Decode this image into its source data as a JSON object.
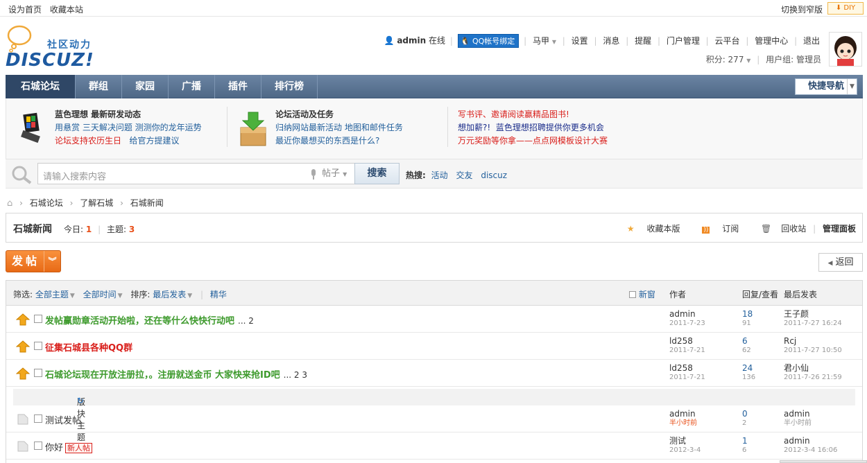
{
  "topbar": {
    "left_links": [
      "设为首页",
      "收藏本站"
    ],
    "right_link": "切换到窄版",
    "diy": "DIY"
  },
  "logo": {
    "brand": "DISCUZ!",
    "slogan": "社区动力"
  },
  "user": {
    "name": "admin",
    "status": "在线",
    "qq_bind": "QQ帐号绑定",
    "menu": [
      "马甲",
      "设置",
      "消息",
      "提醒",
      "门户管理",
      "云平台",
      "管理中心",
      "退出"
    ],
    "score_label": "积分: 277",
    "group_label": "用户组: 管理员"
  },
  "nav": {
    "items": [
      "石城论坛",
      "群组",
      "家园",
      "广播",
      "插件",
      "排行榜"
    ],
    "quick": "快捷导航"
  },
  "feature": {
    "col1": {
      "title": "蓝色理想 最新研发动态",
      "line1": "用悬赏 三天解决问题 测测你的龙年运势",
      "line2a": "论坛支持农历生日",
      "line2b": "给官方提建议"
    },
    "col2": {
      "title": "论坛活动及任务",
      "line1": "归纳网站最新活动 地图和邮件任务",
      "line2": "最近你最想买的东西是什么?"
    },
    "col3": {
      "line1": "写书评、邀请阅读赢精品图书!",
      "line2a": "想加薪?!",
      "line2b": "蓝色理想招聘提供你更多机会",
      "line3": "万元奖励等你拿——点点网模板设计大赛"
    }
  },
  "search": {
    "placeholder": "请输入搜索内容",
    "type": "帖子",
    "button": "搜索",
    "hot_label": "热搜:",
    "hot": [
      "活动",
      "交友",
      "discuz"
    ]
  },
  "breadcrumb": [
    "石城论坛",
    "了解石城",
    "石城新闻"
  ],
  "forum": {
    "title": "石城新闻",
    "today_label": "今日:",
    "today": "1",
    "topics_label": "主题:",
    "topics": "3",
    "actions": [
      "收藏本版",
      "订阅",
      "回收站",
      "管理面板"
    ],
    "post_button": "发帖",
    "back": "返回"
  },
  "threadlist": {
    "filter_label": "筛选:",
    "all_topics": "全部主题",
    "all_time": "全部时间",
    "sort_label": "排序:",
    "sort": "最后发表",
    "digest": "精华",
    "newwin": "新窗",
    "col_author": "作者",
    "col_reply": "回复/查看",
    "col_last": "最后发表",
    "section_label": "版块主题",
    "rows": [
      {
        "subject": "发帖赢勋章活动开始啦，还在等什么快快行动吧",
        "pages": "... 2",
        "author": "admin",
        "date": "2011-7-23",
        "replies": "18",
        "views": "91",
        "last_user": "王子颜",
        "last_time": "2011-7-27 16:24"
      },
      {
        "subject": "征集石城县各种QQ群",
        "pages": "",
        "author": "ld258",
        "date": "2011-7-21",
        "replies": "6",
        "views": "62",
        "last_user": "Rcj",
        "last_time": "2011-7-27 10:50"
      },
      {
        "subject": "石城论坛现在开放注册拉，。注册就送金币 大家快来抢ID吧",
        "pages": "... 2  3",
        "author": "ld258",
        "date": "2011-7-21",
        "replies": "24",
        "views": "136",
        "last_user": "君小仙",
        "last_time": "2011-7-26 21:59"
      },
      {
        "subject": "测试发帖",
        "pages": "",
        "author": "admin",
        "date": "半小时前",
        "replies": "0",
        "views": "2",
        "last_user": "admin",
        "last_time": "半小时前"
      },
      {
        "subject": "你好",
        "tag": "新人帖",
        "author": "测试",
        "date": "2012-3-4",
        "replies": "1",
        "views": "6",
        "last_user": "admin",
        "last_time": "2012-3-4 16:06"
      }
    ]
  }
}
